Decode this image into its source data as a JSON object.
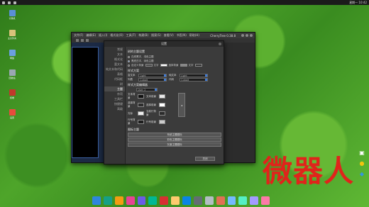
{
  "top_panel": {
    "clock": "星期一 10:42"
  },
  "desktop_icons": [
    {
      "label": "计算机",
      "color": "#5a8fd6"
    },
    {
      "label": "主文件夹",
      "color": "#d9c27a"
    },
    {
      "label": "网络",
      "color": "#6b9fe0"
    },
    {
      "label": "回收站",
      "color": "#9aa7b3"
    },
    {
      "label": "终端",
      "color": "#c0392b"
    },
    {
      "label": "设置",
      "color": "#e74c3c"
    }
  ],
  "main_window": {
    "menu": [
      "文件(F)",
      "编辑(E)",
      "插入(I)",
      "格式化(O)",
      "工具(T)",
      "构建(B)",
      "搜索(S)",
      "查看(V)",
      "书签(N)",
      "帮助(H)"
    ],
    "app_title": "CherryTree 0.38.8"
  },
  "dialog": {
    "title": "设置",
    "sidebar": [
      "常规",
      "文本",
      "格式化",
      "富文本",
      "纯文本和代码",
      "表格",
      "代码框",
      "树",
      "主题",
      "杂项",
      "工具栏",
      "快捷键",
      "高级"
    ],
    "sidebar_selected_index": 8,
    "sec_tree_theme": "树的主题设置",
    "tree_radio_1": "白底黑字，浅色主题",
    "tree_radio_2": "黑底白字，深色主题",
    "tree_radio_3": "自定义背景",
    "tree_text_label": "文字",
    "tree_sel_bg_label": "选择背景",
    "tree_sel_fg_label": "文字",
    "sec_style": "样式方案",
    "rich_label": "富文本",
    "rich_value": "Light",
    "plain_label": "纯文本",
    "plain_value": "Light",
    "code_label": "代码",
    "code_value": "Cobalt",
    "tablist_label": "列表",
    "tablist_value": "Cobalt",
    "sec_custom": "样式方案编辑器",
    "scheme_value": "User 2",
    "hi_rows": [
      {
        "left_label": "文本背景",
        "left_color": "#111111",
        "right_label": "文本前景",
        "right_color": "#e8e8e8"
      },
      {
        "left_label": "选择背景",
        "left_color": "#2d2d2d",
        "right_label": "选择前景",
        "right_color": "#ffffff"
      },
      {
        "left_label": "光标",
        "left_color": "#eeeeee",
        "right_label": "当前行背景",
        "right_color": "#2b2b2b"
      },
      {
        "left_label": "行号背景",
        "left_color": "#1d1d1d",
        "right_label": "行号前景",
        "right_color": "#cccccc"
      }
    ],
    "arrow_glyph": "◂",
    "sec_icons": "图标主题",
    "icon_buttons": [
      "系统主题图标",
      "彩色主题图标",
      "灰度主题图标"
    ],
    "close_label": "关闭"
  },
  "watermark": "微器人",
  "dock_icons": [
    "#2e86de",
    "#16a085",
    "#f39c12",
    "#e84393",
    "#6c5ce7",
    "#00b894",
    "#d63031",
    "#fdcb6e",
    "#0984e3",
    "#636e72",
    "#b2bec3",
    "#e17055",
    "#74b9ff",
    "#55efc4",
    "#a29bfe",
    "#fd79a8"
  ]
}
